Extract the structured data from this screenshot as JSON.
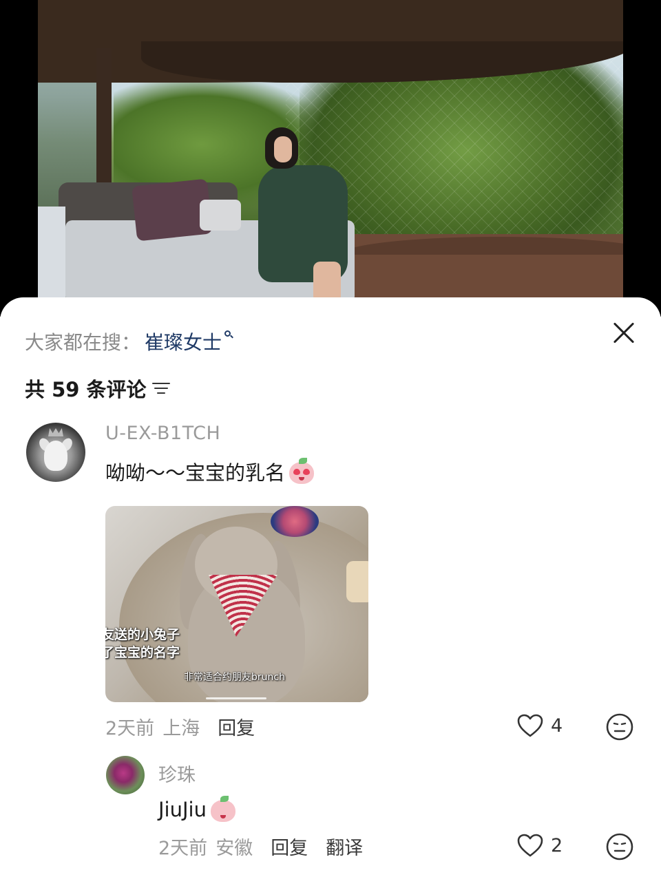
{
  "search": {
    "prefix": "大家都在搜：",
    "term": "崔璨女士"
  },
  "comments_header": {
    "count_label": "共 59 条评论"
  },
  "comments": [
    {
      "username": "U-EX-B1TCH",
      "text": "呦呦～～宝宝的乳名",
      "emoji": "heart-eyes-peach-emoji",
      "image_captions": [
        "友送的小兔子",
        "了宝宝的名字",
        "非常适合约朋友brunch"
      ],
      "time": "2天前",
      "location": "上海",
      "reply_label": "回复",
      "likes": "4"
    },
    {
      "username": "珍珠",
      "text": "JiuJiu",
      "emoji": "kiss-peach-emoji",
      "time": "2天前",
      "location": "安徽",
      "reply_label": "回复",
      "translate_label": "翻译",
      "likes": "2"
    }
  ],
  "colors": {
    "search_term": "#1f3a66",
    "muted": "#9a9a9a",
    "sheet_bg": "#ffffff"
  }
}
